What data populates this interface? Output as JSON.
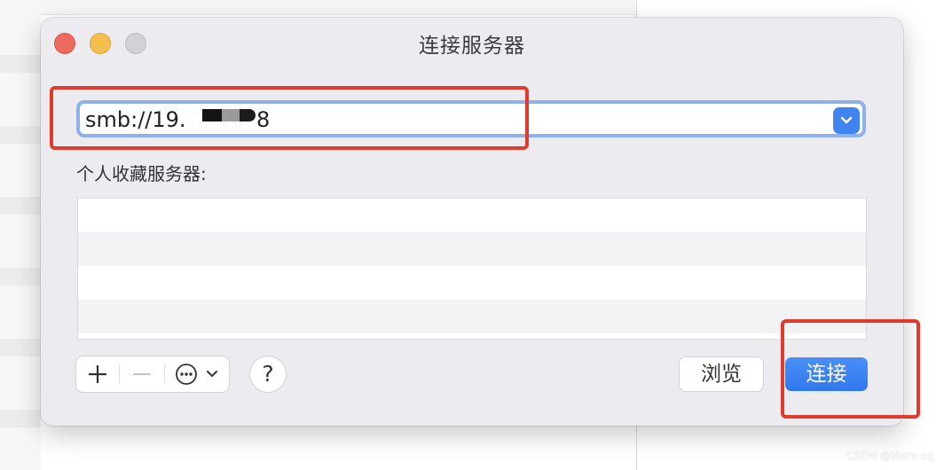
{
  "dialog": {
    "title": "连接服务器",
    "server_address": {
      "prefix": "smb://19.",
      "suffix": "8"
    },
    "favorites_label": "个人收藏服务器:",
    "favorites_rows": [
      "",
      "",
      "",
      ""
    ],
    "toolbar": {
      "add_label": "+",
      "remove_label": "—",
      "help_label": "?"
    },
    "buttons": {
      "browse": "浏览",
      "connect": "连接"
    }
  },
  "watermark": "CSDN @Mars-xq",
  "colors": {
    "accent": "#3f84f0",
    "annotation": "#e03a2a"
  },
  "icons": [
    "chevron-down-icon",
    "plus-icon",
    "minus-icon",
    "ellipsis-circle-icon",
    "chevron-down-icon"
  ]
}
